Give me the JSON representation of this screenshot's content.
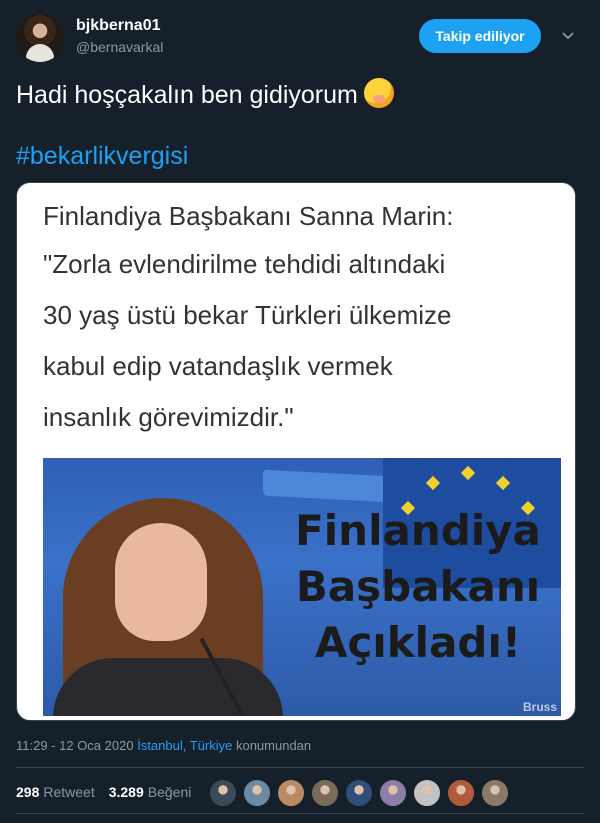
{
  "user": {
    "name": "bjkberna01",
    "handle": "@bernavarkal",
    "follow_label": "Takip ediliyor"
  },
  "tweet": {
    "text": "Hadi hoşçakalın ben gidiyorum",
    "emoji_icon": "face-with-hand-over-mouth-icon",
    "hashtag": "#bekarlikvergisi"
  },
  "media": {
    "quote_title": "Finlandiya Başbakanı Sanna Marin:",
    "quote_lines": [
      "\"Zorla evlendirilme tehdidi altındaki",
      "30 yaş üstü bekar Türkleri ülkemize",
      "kabul edip vatandaşlık vermek",
      "insanlık görevimizdir.\""
    ],
    "headline_lines": [
      "Finlandiya",
      "Başbakanı",
      "Açıkladı!"
    ],
    "corner_text": "Bruss"
  },
  "meta": {
    "time": "11:29 - 12 Oca 2020",
    "location": "İstanbul, Türkiye",
    "location_suffix": "konumundan"
  },
  "stats": {
    "retweets": "298",
    "retweets_label": "Retweet",
    "likes": "3.289",
    "likes_label": "Beğeni"
  },
  "liker_avatars": [
    {
      "color": "#3a4a5a"
    },
    {
      "color": "#6b8aa3"
    },
    {
      "color": "#b88a66"
    },
    {
      "color": "#7a6a58"
    },
    {
      "color": "#2f4f7a"
    },
    {
      "color": "#8d7ea6"
    },
    {
      "color": "#c2c2c2"
    },
    {
      "color": "#b25a3c"
    },
    {
      "color": "#8a7a6a"
    }
  ]
}
